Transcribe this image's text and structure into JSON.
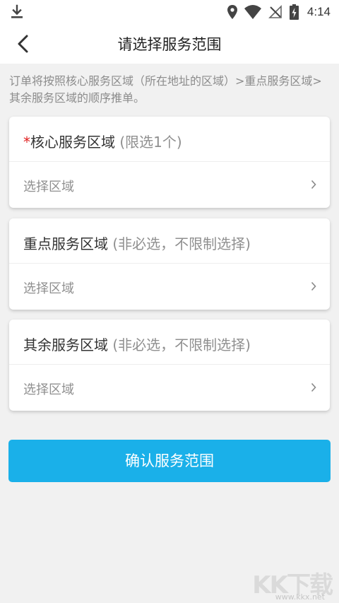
{
  "status_bar": {
    "time": "4:14"
  },
  "header": {
    "title": "请选择服务范围"
  },
  "info_text": "订单将按照核心服务区域（所在地址的区域）>重点服务区域>其余服务区域的顺序推单。",
  "cards": [
    {
      "required_mark": "*",
      "title": "核心服务区域",
      "hint": "(限选1个)",
      "select_label": "选择区域"
    },
    {
      "title": "重点服务区域",
      "hint": "(非必选，不限制选择)",
      "select_label": "选择区域"
    },
    {
      "title": "其余服务区域",
      "hint": "(非必选，不限制选择)",
      "select_label": "选择区域"
    }
  ],
  "confirm_button": "确认服务范围",
  "watermark": {
    "logo": "KK下载",
    "url": "www.kkx.net"
  },
  "colors": {
    "accent": "#1ab0e9",
    "required": "#e02020",
    "background": "#f1f1f1"
  }
}
